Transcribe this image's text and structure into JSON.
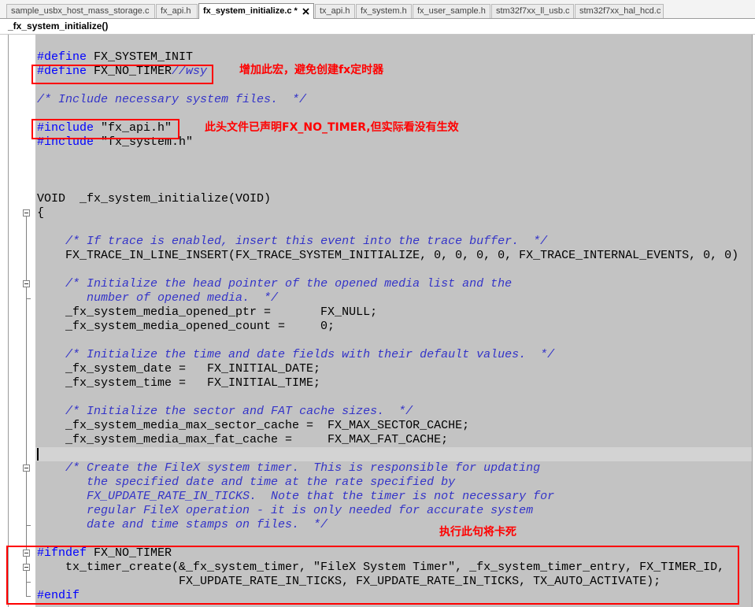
{
  "tabs": [
    {
      "label": "sample_usbx_host_mass_storage.c",
      "active": false
    },
    {
      "label": "fx_api.h",
      "active": false
    },
    {
      "label": "fx_system_initialize.c *",
      "active": true
    },
    {
      "label": "tx_api.h",
      "active": false
    },
    {
      "label": "fx_system.h",
      "active": false
    },
    {
      "label": "fx_user_sample.h",
      "active": false
    },
    {
      "label": "stm32f7xx_ll_usb.c",
      "active": false
    },
    {
      "label": "stm32f7xx_hal_hcd.c",
      "active": false
    }
  ],
  "icons": {
    "tab_close": "close-icon",
    "fold_toggle": "fold-collapse-icon"
  },
  "function_bar": {
    "label": "_fx_system_initialize()"
  },
  "colors": {
    "editor_background": "#c3c3c3",
    "current_line": "#d3d3d3",
    "annotation": "#ff0000",
    "directive": "#0000ff",
    "comment": "#3434c8"
  },
  "editor": {
    "lines": [
      {
        "tokens": [
          {
            "text": "#define",
            "color": "#0000ff"
          },
          {
            "text": " FX_SYSTEM_INIT"
          }
        ]
      },
      {
        "tokens": [
          {
            "text": "#define",
            "color": "#0000ff"
          },
          {
            "text": " FX_NO_TIMER"
          },
          {
            "text": "//wsy",
            "color": "#3434c8",
            "italic": true
          }
        ]
      },
      {
        "tokens": []
      },
      {
        "tokens": [
          {
            "text": "/* Include necessary system files.  */",
            "color": "#3434c8",
            "italic": true
          }
        ]
      },
      {
        "tokens": []
      },
      {
        "tokens": [
          {
            "text": "#include",
            "color": "#0000ff"
          },
          {
            "text": " \"fx_api.h\""
          }
        ]
      },
      {
        "tokens": [
          {
            "text": "#include",
            "color": "#0000ff"
          },
          {
            "text": " \"fx_system.h\""
          }
        ]
      },
      {
        "tokens": []
      },
      {
        "tokens": []
      },
      {
        "tokens": []
      },
      {
        "tokens": [
          {
            "text": "VOID  _fx_system_initialize(VOID)"
          }
        ]
      },
      {
        "tokens": [
          {
            "text": "{"
          }
        ],
        "fold_start": true
      },
      {
        "tokens": []
      },
      {
        "tokens": [
          {
            "text": "    "
          },
          {
            "text": "/* If trace is enabled, insert this event into the trace buffer.  */",
            "color": "#3434c8",
            "italic": true
          }
        ]
      },
      {
        "tokens": [
          {
            "text": "    FX_TRACE_IN_LINE_INSERT(FX_TRACE_SYSTEM_INITIALIZE, 0, 0, 0, 0, FX_TRACE_INTERNAL_EVENTS, 0, 0)"
          }
        ]
      },
      {
        "tokens": []
      },
      {
        "tokens": [
          {
            "text": "    "
          },
          {
            "text": "/* Initialize the head pointer of the opened media list and the",
            "color": "#3434c8",
            "italic": true
          }
        ],
        "fold_start": true
      },
      {
        "tokens": [
          {
            "text": "       number of opened media.  */",
            "color": "#3434c8",
            "italic": true
          }
        ],
        "fold_end": true
      },
      {
        "tokens": [
          {
            "text": "    _fx_system_media_opened_ptr =       FX_NULL;"
          }
        ]
      },
      {
        "tokens": [
          {
            "text": "    _fx_system_media_opened_count =     0;"
          }
        ]
      },
      {
        "tokens": []
      },
      {
        "tokens": [
          {
            "text": "    "
          },
          {
            "text": "/* Initialize the time and date fields with their default values.  */",
            "color": "#3434c8",
            "italic": true
          }
        ]
      },
      {
        "tokens": [
          {
            "text": "    _fx_system_date =   FX_INITIAL_DATE;"
          }
        ]
      },
      {
        "tokens": [
          {
            "text": "    _fx_system_time =   FX_INITIAL_TIME;"
          }
        ]
      },
      {
        "tokens": []
      },
      {
        "tokens": [
          {
            "text": "    "
          },
          {
            "text": "/* Initialize the sector and FAT cache sizes.  */",
            "color": "#3434c8",
            "italic": true
          }
        ]
      },
      {
        "tokens": [
          {
            "text": "    _fx_system_media_max_sector_cache =  FX_MAX_SECTOR_CACHE;"
          }
        ]
      },
      {
        "tokens": [
          {
            "text": "    _fx_system_media_max_fat_cache =     FX_MAX_FAT_CACHE;"
          }
        ]
      },
      {
        "tokens": [],
        "current": true
      },
      {
        "tokens": [
          {
            "text": "    "
          },
          {
            "text": "/* Create the FileX system timer.  This is responsible for updating",
            "color": "#3434c8",
            "italic": true
          }
        ],
        "fold_start": true
      },
      {
        "tokens": [
          {
            "text": "       the specified date and time at the rate specified by",
            "color": "#3434c8",
            "italic": true
          }
        ]
      },
      {
        "tokens": [
          {
            "text": "       FX_UPDATE_RATE_IN_TICKS.  Note that the timer is not necessary for",
            "color": "#3434c8",
            "italic": true
          }
        ]
      },
      {
        "tokens": [
          {
            "text": "       regular FileX operation - it is only needed for accurate system",
            "color": "#3434c8",
            "italic": true
          }
        ]
      },
      {
        "tokens": [
          {
            "text": "       date and time stamps on files.  */",
            "color": "#3434c8",
            "italic": true
          }
        ],
        "fold_end": true
      },
      {
        "tokens": []
      },
      {
        "tokens": [
          {
            "text": "#ifndef",
            "color": "#0000ff"
          },
          {
            "text": " FX_NO_TIMER"
          }
        ],
        "fold_start": true
      },
      {
        "tokens": [
          {
            "text": "    tx_timer_create(&_fx_system_timer, \"FileX System Timer\", _fx_system_timer_entry, FX_TIMER_ID,"
          }
        ],
        "fold_start": true
      },
      {
        "tokens": [
          {
            "text": "                    FX_UPDATE_RATE_IN_TICKS, FX_UPDATE_RATE_IN_TICKS, TX_AUTO_ACTIVATE);"
          }
        ],
        "fold_end": true
      },
      {
        "tokens": [
          {
            "text": "#endif",
            "color": "#0000ff"
          }
        ],
        "fold_end": true
      }
    ]
  },
  "annotations": [
    {
      "text": "增加此宏，避免创建fx定时器"
    },
    {
      "text": "此头文件已声明FX_NO_TIMER,但实际看没有生效"
    },
    {
      "text": "执行此句将卡死"
    }
  ]
}
